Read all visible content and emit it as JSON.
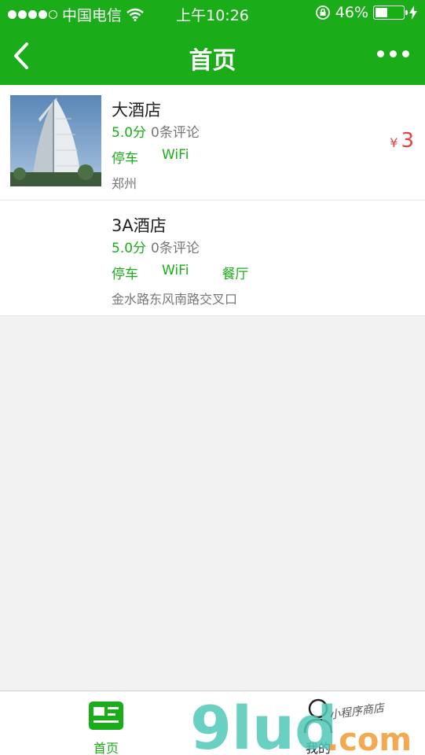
{
  "status_bar": {
    "carrier": "中国电信",
    "time": "上午10:26",
    "battery_percent": "46%",
    "battery_level": 0.46,
    "signal_bars": 4,
    "icons": [
      "wifi-icon",
      "rotation-lock-icon",
      "battery-icon",
      "charging-icon"
    ]
  },
  "nav": {
    "title": "首页",
    "back_icon": "chevron-left-icon",
    "more_icon": "more-dots-icon"
  },
  "hotels": [
    {
      "name": "大酒店",
      "score": "5.0分",
      "reviews": "0条评论",
      "tags": [
        "停车",
        "WiFi"
      ],
      "address": "郑州",
      "price_symbol": "¥",
      "price": "3",
      "has_image": true
    },
    {
      "name": "3A酒店",
      "score": "5.0分",
      "reviews": "0条评论",
      "tags": [
        "停车",
        "WiFi",
        "餐厅"
      ],
      "address": "金水路东风南路交叉口",
      "has_image": false
    }
  ],
  "tabbar": {
    "home_label": "首页",
    "mine_label": "我的"
  },
  "watermark": {
    "brand": "9lud",
    "domain": ".com",
    "tagline": "小程序商店"
  },
  "colors": {
    "brand_green": "#1aad19",
    "price_red": "#e64340",
    "background": "#f2f2f2"
  }
}
